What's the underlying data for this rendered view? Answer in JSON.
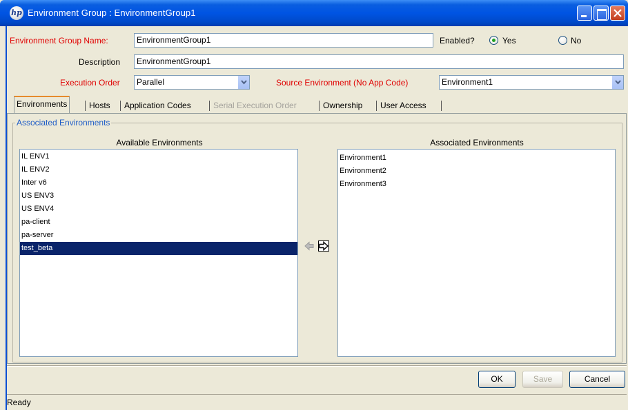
{
  "window": {
    "title": "Environment Group : EnvironmentGroup1",
    "app_icon_text": "hp",
    "controls": [
      "minimize-icon",
      "maximize-icon",
      "close-icon"
    ]
  },
  "form": {
    "group_name_label": "Environment Group Name:",
    "group_name_value": "EnvironmentGroup1",
    "enabled_label": "Enabled?",
    "enabled_yes": "Yes",
    "enabled_no": "No",
    "enabled_selected": "Yes",
    "description_label": "Description",
    "description_value": "EnvironmentGroup1",
    "execution_order_label": "Execution Order",
    "execution_order_value": "Parallel",
    "source_env_label": "Source Environment (No App Code)",
    "source_env_value": "Environment1"
  },
  "tabs": [
    {
      "label": "Environments",
      "active": true,
      "enabled": true
    },
    {
      "label": "Hosts",
      "active": false,
      "enabled": true
    },
    {
      "label": "Application Codes",
      "active": false,
      "enabled": true
    },
    {
      "label": "Serial Execution Order",
      "active": false,
      "enabled": false
    },
    {
      "label": "Ownership",
      "active": false,
      "enabled": true
    },
    {
      "label": "User Access",
      "active": false,
      "enabled": true
    }
  ],
  "associated": {
    "group_title": "Associated Environments",
    "available_title": "Available Environments",
    "associated_title": "Associated Environments",
    "available": [
      "IL ENV1",
      "IL ENV2",
      "Inter v6",
      "US ENV3",
      "US ENV4",
      "pa-client",
      "pa-server",
      "test_beta"
    ],
    "available_selected": "test_beta",
    "associated": [
      "Environment1",
      "Environment2",
      "Environment3"
    ]
  },
  "buttons": {
    "ok": "OK",
    "save": "Save",
    "cancel": "Cancel"
  },
  "status": "Ready",
  "colors": {
    "title_bar": "#0054e3",
    "required_label": "#e00000",
    "group_legend": "#1f5dc7",
    "selection": "#0a246a",
    "active_tab_accent": "#e68b2c"
  }
}
